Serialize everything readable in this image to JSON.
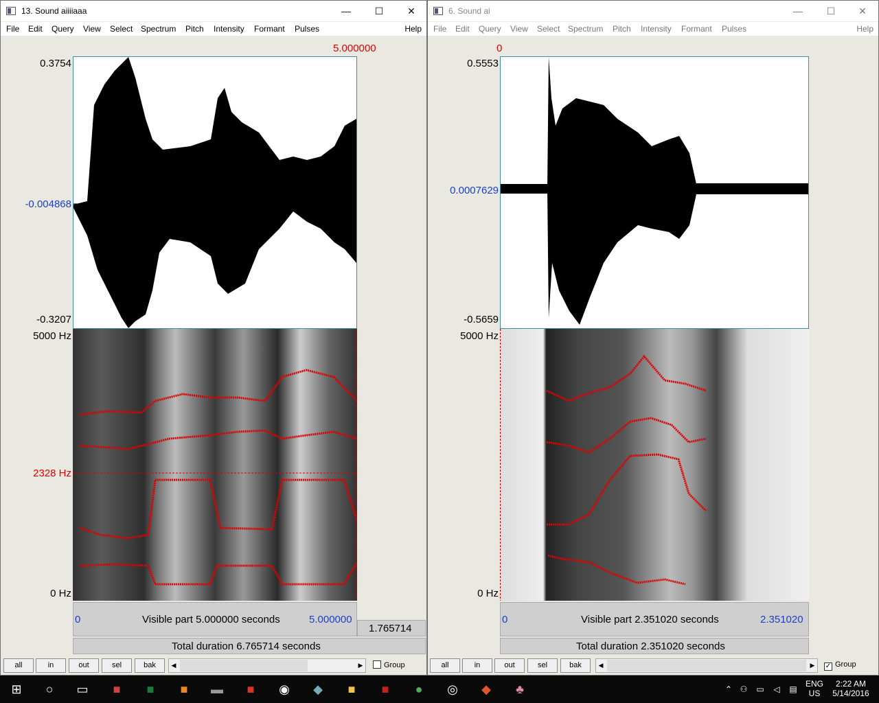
{
  "window1": {
    "title": "13. Sound aiiiiaaa",
    "menu": [
      "File",
      "Edit",
      "Query",
      "View",
      "Select",
      "Spectrum",
      "Pitch",
      "Intensity",
      "Formant",
      "Pulses"
    ],
    "help": "Help",
    "cursor_time": "5.000000",
    "wave_max": "0.3754",
    "wave_mid": "-0.004868",
    "wave_min": "-0.3207",
    "spec_top": "5000 Hz",
    "spec_cursor": "2328 Hz",
    "spec_bottom": "0 Hz",
    "visible_start": "0",
    "visible_label": "Visible part 5.000000 seconds",
    "visible_end": "5.000000",
    "remaining": "1.765714",
    "total_label": "Total duration 6.765714 seconds",
    "buttons": [
      "all",
      "in",
      "out",
      "sel",
      "bak"
    ],
    "group_label": "Group",
    "group_checked": false
  },
  "window2": {
    "title": "6. Sound ai",
    "menu": [
      "File",
      "Edit",
      "Query",
      "View",
      "Select",
      "Spectrum",
      "Pitch",
      "Intensity",
      "Formant",
      "Pulses"
    ],
    "help": "Help",
    "cursor_time": "0",
    "wave_max": "0.5553",
    "wave_mid": "0.0007629",
    "wave_min": "-0.5659",
    "spec_top": "5000 Hz",
    "spec_bottom": "0 Hz",
    "visible_start": "0",
    "visible_label": "Visible part 2.351020 seconds",
    "visible_end": "2.351020",
    "total_label": "Total duration 2.351020 seconds",
    "buttons": [
      "all",
      "in",
      "out",
      "sel",
      "bak"
    ],
    "group_label": "Group",
    "group_checked": true
  },
  "window_controls": {
    "minimize": "—",
    "maximize": "☐",
    "close": "✕"
  },
  "taskbar": {
    "apps": [
      "start-icon",
      "cortana-icon",
      "task-view-icon",
      "winrar-icon",
      "excel-icon",
      "sublime-icon",
      "terminal-icon",
      "filezilla-icon",
      "steam-icon",
      "virtualbox-icon",
      "file-explorer-icon",
      "acrobat-icon",
      "chrome-icon",
      "media-icon",
      "git-icon",
      "praat-icon"
    ],
    "lang": "ENG",
    "region": "US",
    "time": "2:22 AM",
    "date": "5/14/2016"
  },
  "colors": {
    "formant": "#e00000",
    "cursor": "#e00000",
    "axis_blue": "#1a3ecc",
    "plot_border": "#3b8fa0"
  }
}
